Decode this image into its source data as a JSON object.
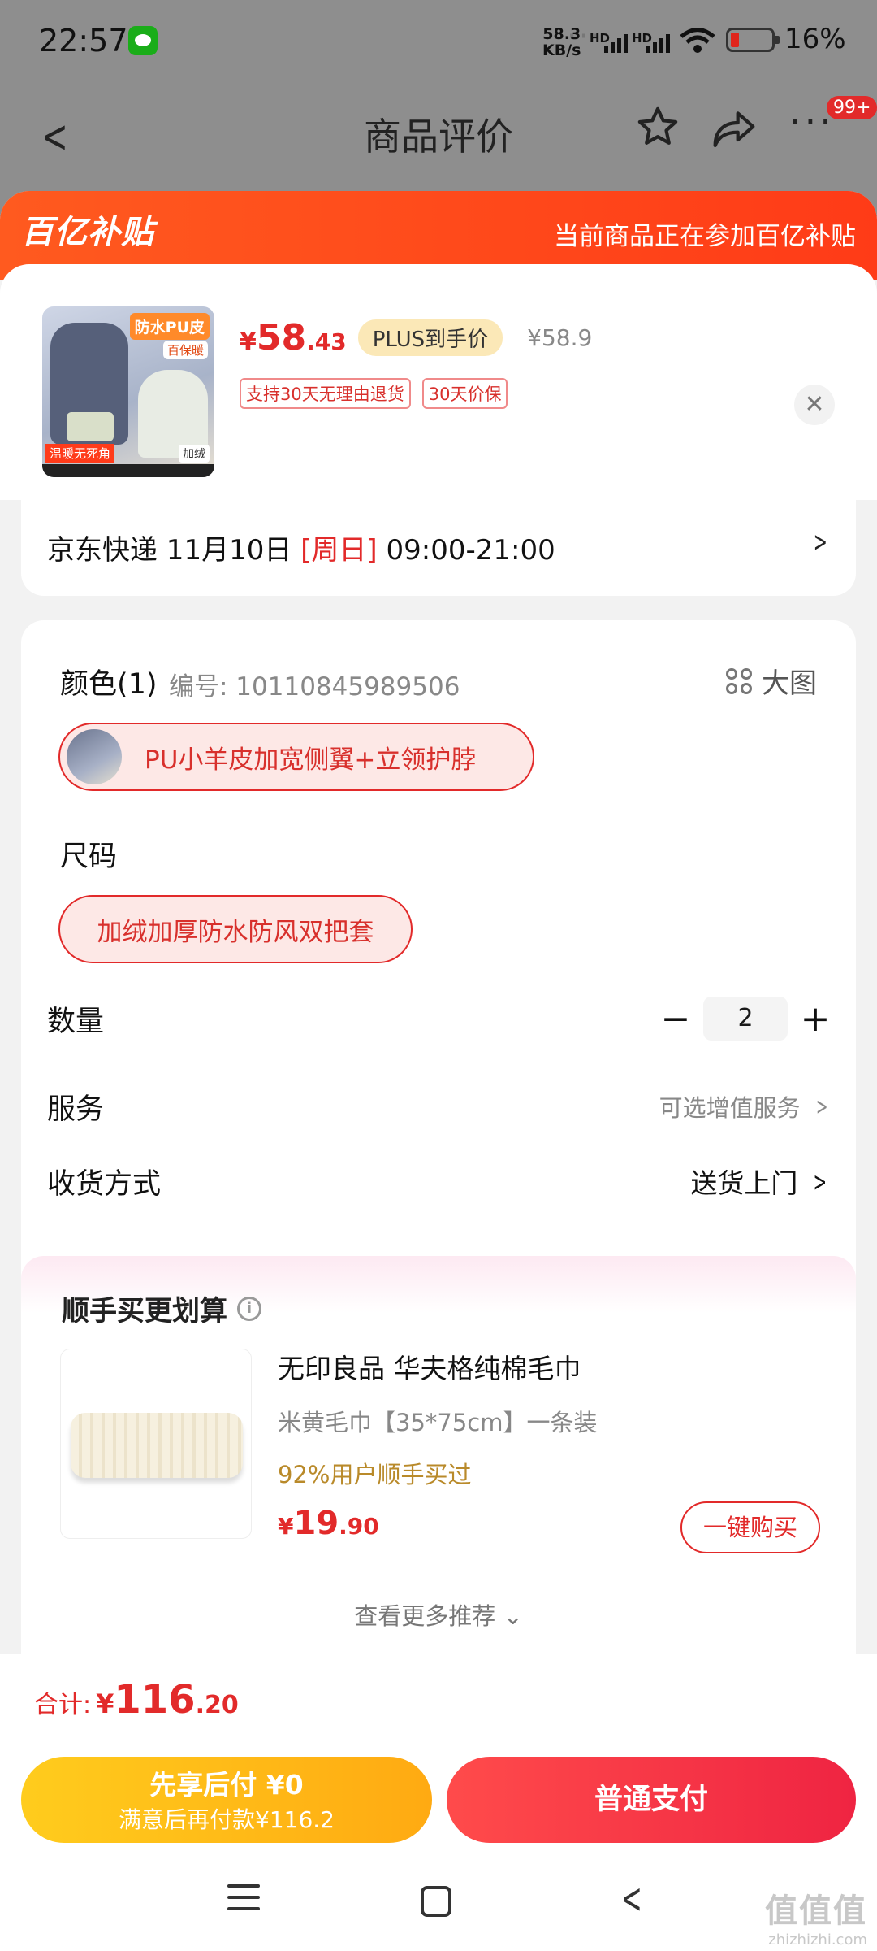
{
  "status_bar": {
    "time": "22:57",
    "app_icon": "wechat-icon",
    "speed_value": "58.3",
    "speed_unit": "KB/s",
    "sim1": "HD",
    "sim2": "HD",
    "battery": "16%",
    "battery_color": "#e0251c"
  },
  "header": {
    "title": "商品评价",
    "badge": "99+"
  },
  "banner": {
    "logo": "百亿补贴",
    "note": "当前商品正在参加百亿补贴"
  },
  "product": {
    "image_tag": "防水PU皮",
    "image_subtag": "百保暖",
    "image_warm": "温暖无死角",
    "image_plus": "加绒",
    "price_currency": "¥",
    "price_int": "58",
    "price_dec": ".43",
    "plus_label": "PLUS到手价",
    "original_price": "¥58.9",
    "tags": [
      "支持30天无理由退货",
      "30天价保"
    ]
  },
  "delivery": {
    "prefix": "京东快递 11月10日 ",
    "weekday": "[周日]",
    "time_range": " 09:00-21:00"
  },
  "spec": {
    "color_label": "颜色(1)",
    "code": "编号: 10110845989506",
    "big_image": "大图",
    "color_option": "PU小羊皮加宽侧翼+立领护脖",
    "size_label": "尺码",
    "size_option": "加绒加厚防水防风双把套",
    "qty_label": "数量",
    "qty_value": "2",
    "service_label": "服务",
    "service_value": "可选增值服务",
    "ship_label": "收货方式",
    "ship_value": "送货上门"
  },
  "recommend": {
    "title": "顺手买更划算",
    "name": "无印良品 华夫格纯棉毛巾",
    "sku": "米黄毛巾【35*75cm】一条装",
    "bought": "92%用户顺手买过",
    "price_currency": "¥",
    "price_int": "19",
    "price_dec": ".90",
    "buy_label": "一键购买",
    "more_label": "查看更多推荐 ⌄"
  },
  "footer": {
    "total_label": "合计:",
    "total_currency": "¥",
    "total_int": "116",
    "total_dec": ".20",
    "paylater_line1": "先享后付 ¥0",
    "paylater_line2": "满意后再付款¥116.2",
    "pay_label": "普通支付"
  },
  "watermark": {
    "main": "值值值",
    "sub": "zhizhizhi.com"
  },
  "colors": {
    "accent_red": "#e22a2a",
    "banner_orange": "#ff4a1a",
    "paylater_yellow": "#ffbb16"
  }
}
